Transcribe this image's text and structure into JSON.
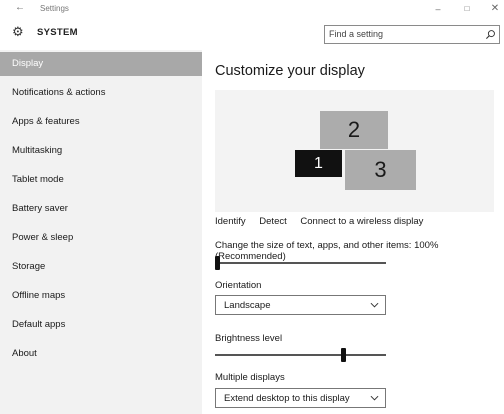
{
  "titlebar": {
    "back_glyph": "←",
    "title": "Settings",
    "minimize_glyph": "–",
    "maximize_glyph": "□",
    "close_glyph": "✕"
  },
  "header": {
    "title": "SYSTEM",
    "gear_glyph": "⚙",
    "search_placeholder": "Find a setting"
  },
  "sidebar": {
    "items": [
      {
        "label": "Display",
        "selected": true
      },
      {
        "label": "Notifications & actions",
        "selected": false
      },
      {
        "label": "Apps & features",
        "selected": false
      },
      {
        "label": "Multitasking",
        "selected": false
      },
      {
        "label": "Tablet mode",
        "selected": false
      },
      {
        "label": "Battery saver",
        "selected": false
      },
      {
        "label": "Power & sleep",
        "selected": false
      },
      {
        "label": "Storage",
        "selected": false
      },
      {
        "label": "Offline maps",
        "selected": false
      },
      {
        "label": "Default apps",
        "selected": false
      },
      {
        "label": "About",
        "selected": false
      }
    ]
  },
  "main": {
    "title": "Customize your display",
    "monitors": [
      "1",
      "2",
      "3"
    ],
    "identify_label": "Identify",
    "detect_label": "Detect",
    "connect_label": "Connect to a wireless display",
    "scale_label": "Change the size of text, apps, and other items: 100% (Recommended)",
    "scale_slider_fraction": 0.0,
    "orientation_label": "Orientation",
    "orientation_value": "Landscape",
    "brightness_label": "Brightness level",
    "brightness_fraction": 0.76,
    "multiple_displays_label": "Multiple displays",
    "multiple_displays_value": "Extend desktop to this display"
  },
  "colors": {
    "selected_nav_bg": "#a8a8a8",
    "sidebar_bg": "#f2f2f2",
    "monitor_fill": "#acacac",
    "primary_monitor_fill": "#111111"
  }
}
